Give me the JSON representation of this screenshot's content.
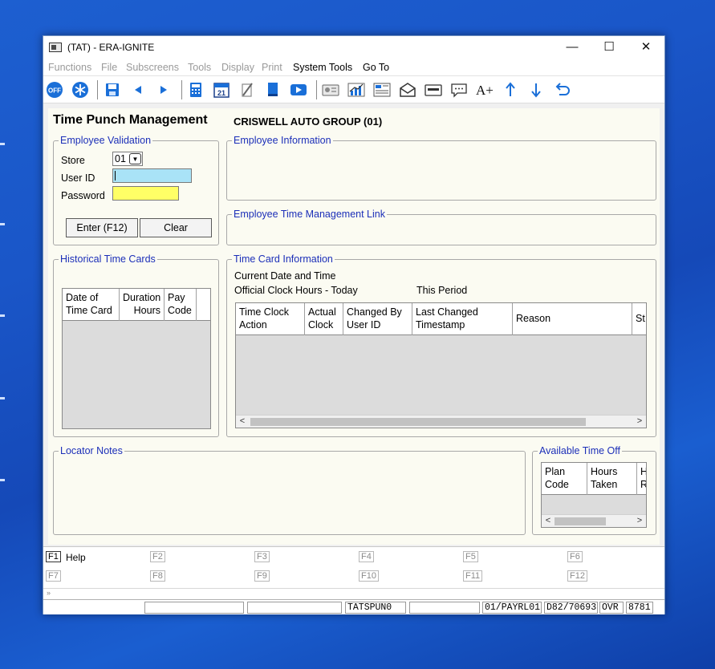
{
  "window": {
    "title": "(TAT) - ERA-IGNITE",
    "minimize": "—",
    "maximize": "☐",
    "close": "✕"
  },
  "menu": {
    "items": [
      {
        "label": "Functions",
        "disabled": true
      },
      {
        "label": "File",
        "disabled": true
      },
      {
        "label": "Subscreens",
        "disabled": true
      },
      {
        "label": "Tools",
        "disabled": true
      },
      {
        "label": "Display",
        "disabled": true
      },
      {
        "label": "Print",
        "disabled": true
      },
      {
        "label": "System Tools",
        "disabled": false
      },
      {
        "label": "Go To",
        "disabled": false
      }
    ]
  },
  "toolbar": {
    "icons": [
      "off-icon",
      "asterisk-icon",
      "save-icon",
      "arrow-left-icon",
      "arrow-right-icon",
      "calculator-icon",
      "calendar-icon",
      "pencil-icon",
      "book-icon",
      "video-icon",
      "id-card-icon",
      "chart-icon",
      "report-icon",
      "mail-icon",
      "card-icon",
      "chat-icon",
      "font-size-icon",
      "arrow-up-icon",
      "arrow-down-icon",
      "undo-icon"
    ],
    "off_label": "OFF",
    "calendar_day": "21",
    "font_label": "A+"
  },
  "page": {
    "title": "Time Punch Management",
    "company": "CRISWELL AUTO GROUP (01)"
  },
  "employee_validation": {
    "legend": "Employee Validation",
    "store_label": "Store",
    "store_value": "01",
    "user_id_label": "User ID",
    "user_id_value": "",
    "password_label": "Password",
    "password_value": "",
    "enter_button": "Enter (F12)",
    "clear_button": "Clear"
  },
  "employee_information": {
    "legend": "Employee Information"
  },
  "employee_time_link": {
    "legend": "Employee Time Management Link"
  },
  "historical_time_cards": {
    "legend": "Historical Time Cards",
    "columns": [
      "Date of Time Card",
      "Duration Hours",
      "Pay Code"
    ]
  },
  "time_card_information": {
    "legend": "Time Card Information",
    "current_date_label": "Current Date and Time",
    "official_hours_label": "Official Clock Hours - Today",
    "this_period_label": "This Period",
    "columns": [
      "Time Clock Action",
      "Actual Clock",
      "Changed By User ID",
      "Last Changed Timestamp",
      "Reason",
      "St"
    ]
  },
  "locator_notes": {
    "legend": "Locator Notes"
  },
  "available_time_off": {
    "legend": "Available Time Off",
    "columns": [
      "Plan Code",
      "Hours Taken",
      "H R"
    ]
  },
  "function_keys": [
    {
      "key": "F1",
      "label": "Help",
      "active": true
    },
    {
      "key": "F2",
      "label": "",
      "active": false
    },
    {
      "key": "F3",
      "label": "",
      "active": false
    },
    {
      "key": "F4",
      "label": "",
      "active": false
    },
    {
      "key": "F5",
      "label": "",
      "active": false
    },
    {
      "key": "F6",
      "label": "",
      "active": false
    },
    {
      "key": "F7",
      "label": "",
      "active": false
    },
    {
      "key": "F8",
      "label": "",
      "active": false
    },
    {
      "key": "F9",
      "label": "",
      "active": false
    },
    {
      "key": "F10",
      "label": "",
      "active": false
    },
    {
      "key": "F11",
      "label": "",
      "active": false
    },
    {
      "key": "F12",
      "label": "",
      "active": false
    }
  ],
  "command_line": "»",
  "status_bar": [
    "",
    "",
    "TATSPUN0",
    "",
    "01/PAYRL01",
    "D82/70693",
    "OVR",
    "8781"
  ],
  "colors": {
    "legend_blue": "#1c2fb8",
    "userid_bg": "#a9e3f7",
    "password_bg": "#ffff66",
    "toolbar_blue": "#1a6fd8"
  }
}
